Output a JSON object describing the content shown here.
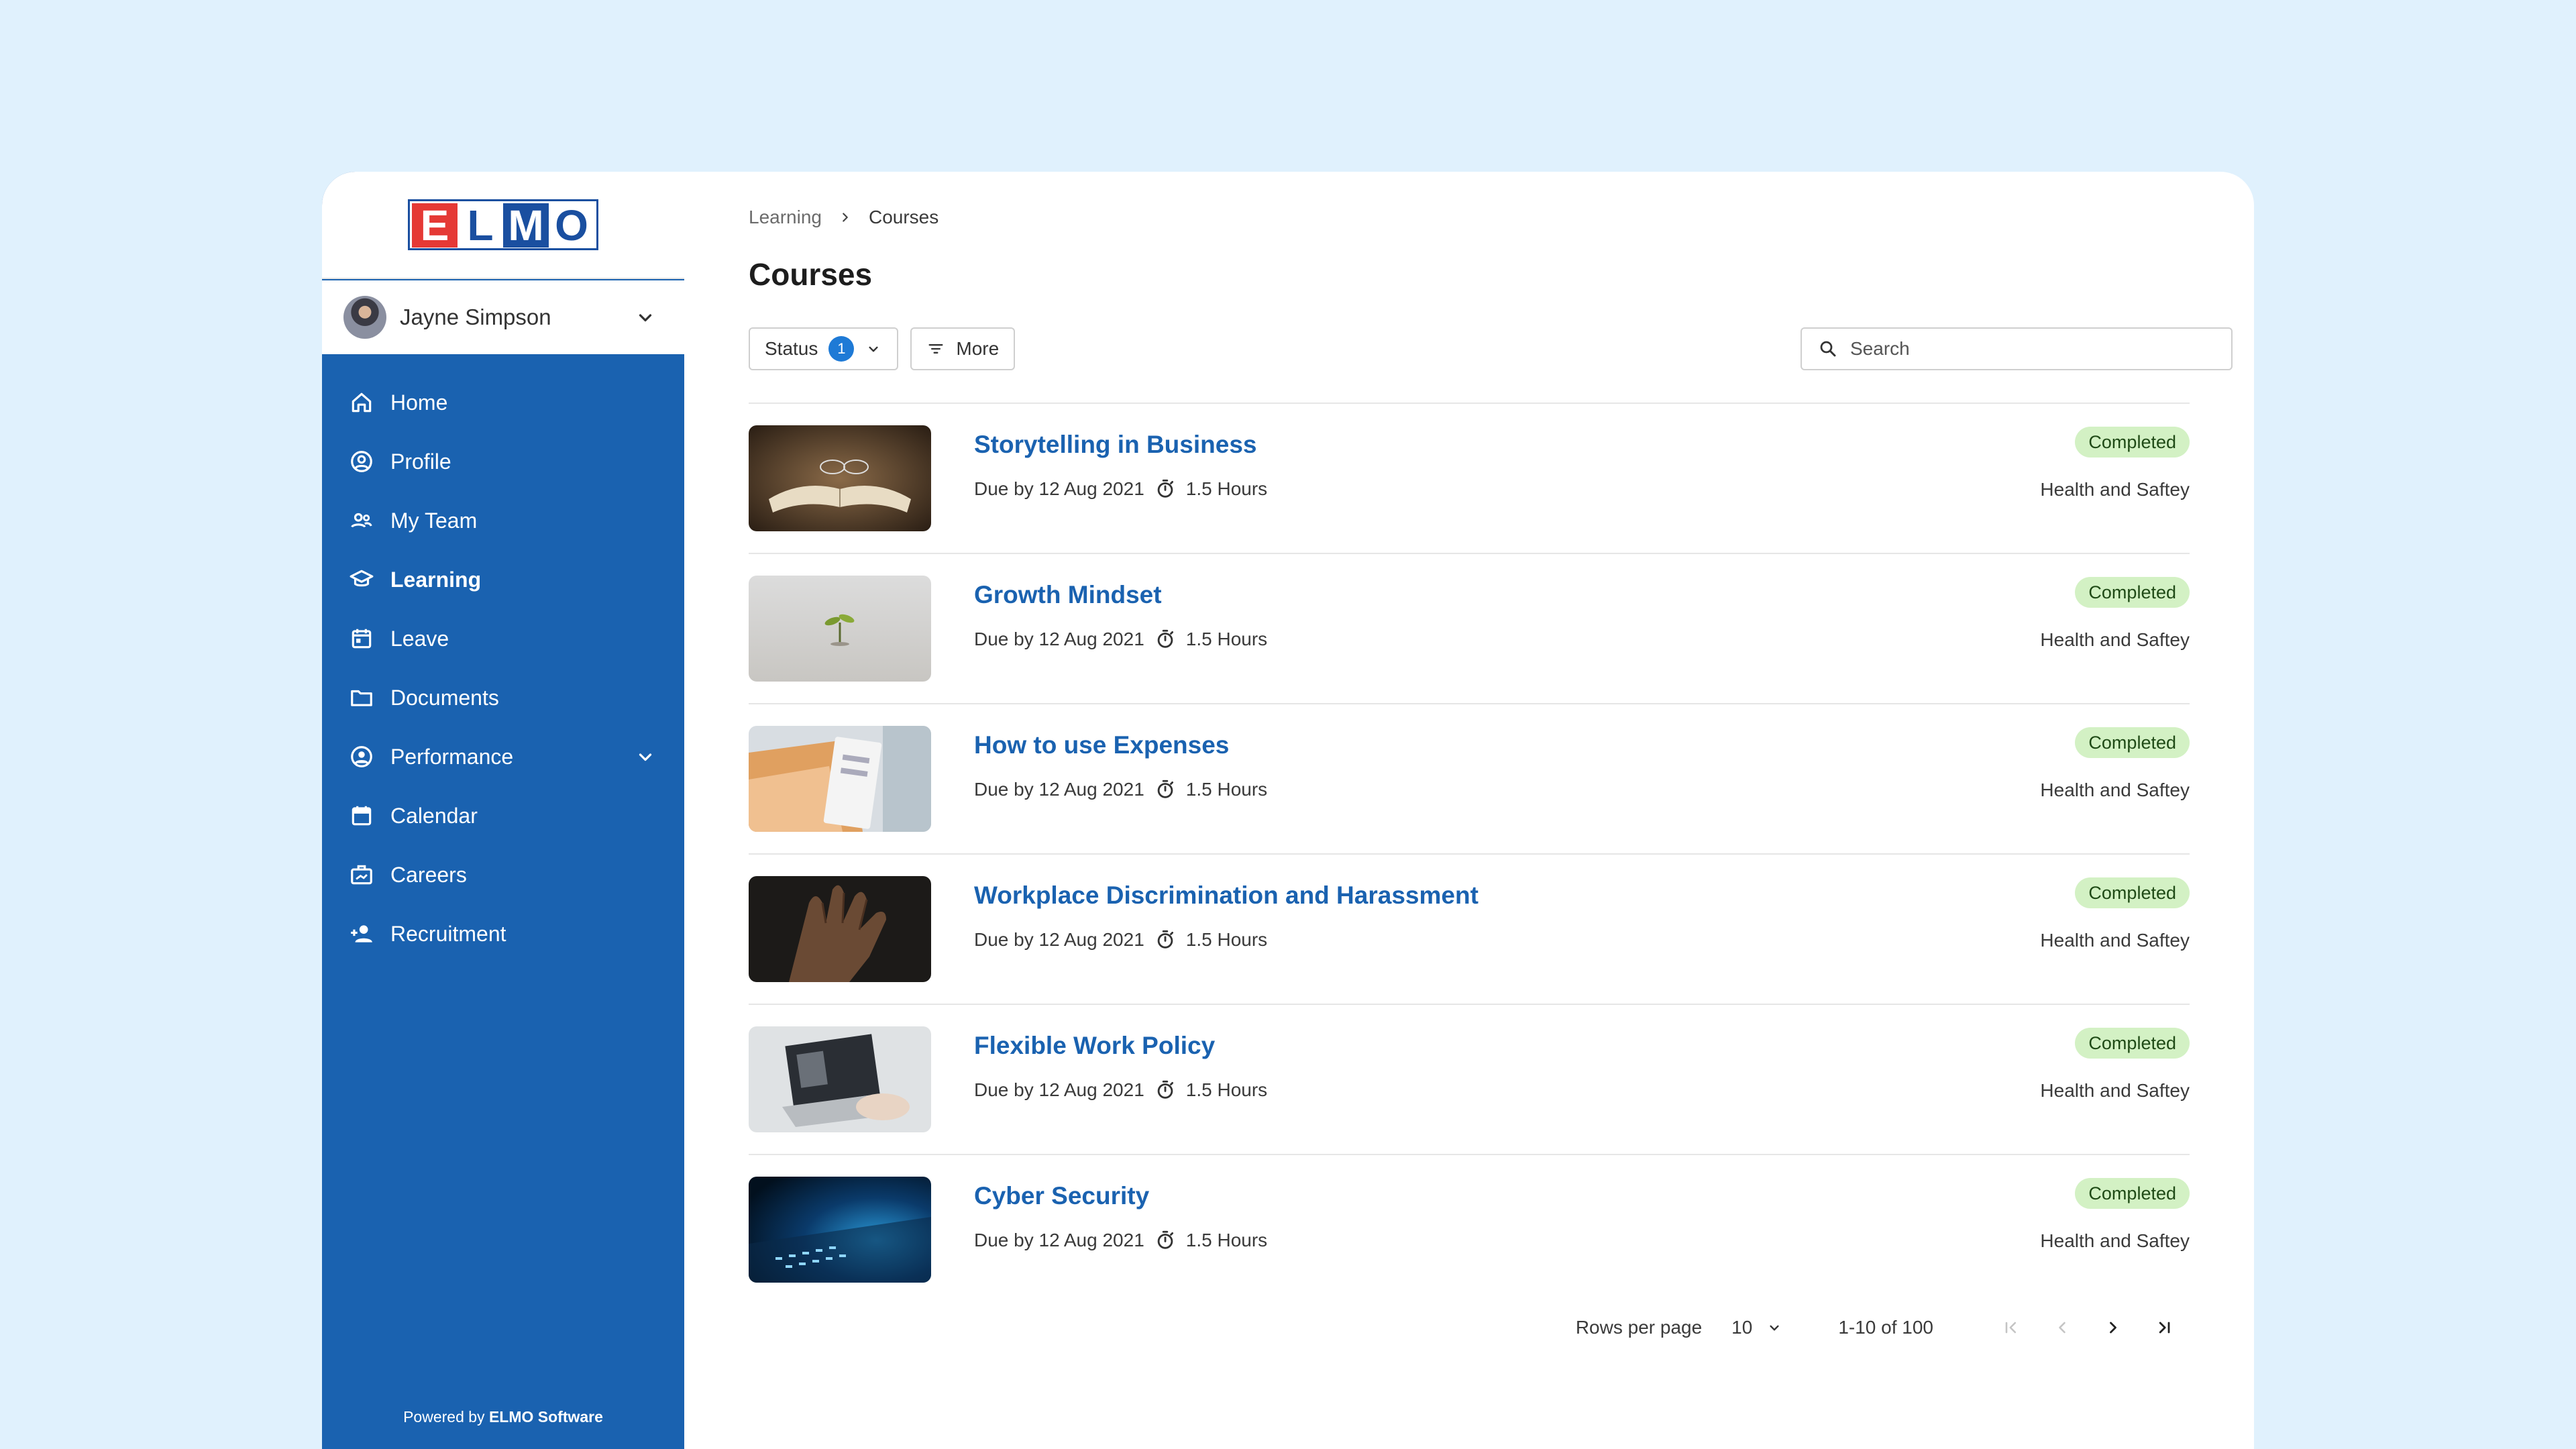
{
  "brand": {
    "logo_letters": [
      "E",
      "L",
      "M",
      "O"
    ],
    "colors": {
      "red": "#e53935",
      "blue": "#1a4fa0",
      "sidebar": "#1a62b0"
    }
  },
  "user": {
    "name": "Jayne Simpson"
  },
  "nav": {
    "items": [
      {
        "label": "Home",
        "icon": "home-icon"
      },
      {
        "label": "Profile",
        "icon": "profile-icon"
      },
      {
        "label": "My Team",
        "icon": "team-icon"
      },
      {
        "label": "Learning",
        "icon": "graduation-cap-icon",
        "active": true
      },
      {
        "label": "Leave",
        "icon": "leave-calendar-icon"
      },
      {
        "label": "Documents",
        "icon": "folder-icon"
      },
      {
        "label": "Performance",
        "icon": "performance-icon",
        "expandable": true
      },
      {
        "label": "Calendar",
        "icon": "calendar-icon"
      },
      {
        "label": "Careers",
        "icon": "briefcase-icon"
      },
      {
        "label": "Recruitment",
        "icon": "add-person-icon"
      }
    ]
  },
  "footer": {
    "powered_by": "Powered by",
    "company": "ELMO Software"
  },
  "breadcrumb": {
    "parent": "Learning",
    "current": "Courses"
  },
  "page": {
    "title": "Courses"
  },
  "filters": {
    "status_label": "Status",
    "status_count": "1",
    "more_label": "More"
  },
  "search": {
    "placeholder": "Search"
  },
  "courses": [
    {
      "title": "Storytelling in Business",
      "due": "Due by 12 Aug 2021",
      "duration": "1.5 Hours",
      "status": "Completed",
      "category": "Health and Saftey"
    },
    {
      "title": "Growth Mindset",
      "due": "Due by 12 Aug 2021",
      "duration": "1.5 Hours",
      "status": "Completed",
      "category": "Health and Saftey"
    },
    {
      "title": "How to use Expenses",
      "due": "Due by 12 Aug 2021",
      "duration": "1.5 Hours",
      "status": "Completed",
      "category": "Health and Saftey"
    },
    {
      "title": "Workplace Discrimination and Harassment",
      "due": "Due by 12 Aug 2021",
      "duration": "1.5 Hours",
      "status": "Completed",
      "category": "Health and Saftey"
    },
    {
      "title": "Flexible Work Policy",
      "due": "Due by 12 Aug 2021",
      "duration": "1.5 Hours",
      "status": "Completed",
      "category": "Health and Saftey"
    },
    {
      "title": "Cyber Security",
      "due": "Due by 12 Aug 2021",
      "duration": "1.5 Hours",
      "status": "Completed",
      "category": "Health and Saftey"
    }
  ],
  "pagination": {
    "rows_per_page_label": "Rows per page",
    "rows_per_page": "10",
    "range": "1-10 of 100"
  }
}
